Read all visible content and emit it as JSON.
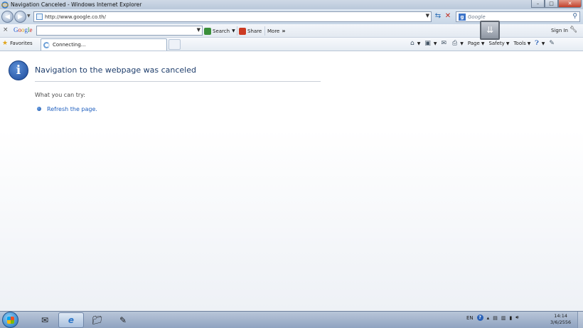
{
  "window": {
    "title": "Navigation Canceled - Windows Internet Explorer",
    "minimize": "–",
    "maximize": "□",
    "close": "✕"
  },
  "address_bar": {
    "url": "http://www.google.co.th/",
    "search_placeholder": "Google"
  },
  "google_toolbar": {
    "logo": [
      "G",
      "o",
      "o",
      "g",
      "l",
      "e"
    ],
    "search_label": "Search",
    "share_label": "Share",
    "more_label": "More",
    "more_glyph": "»",
    "sign_in_label": "Sign In"
  },
  "favorites_bar": {
    "favorites_label": "Favorites",
    "tab_label": "Connecting..."
  },
  "command_bar": {
    "page_label": "Page",
    "safety_label": "Safety",
    "tools_label": "Tools"
  },
  "content": {
    "heading": "Navigation to the webpage was canceled",
    "try_label": "What you can try:",
    "refresh_link": "Refresh the page."
  },
  "taskbar": {
    "language": "EN",
    "time": "14:14",
    "date": "3/6/2556"
  },
  "icons": [
    "ie-icon",
    "back-icon",
    "forward-icon",
    "refresh-icon",
    "stop-icon",
    "search-icon",
    "info-icon",
    "home-icon",
    "feeds-icon",
    "mail-icon",
    "print-icon",
    "help-icon",
    "favorites-star-icon",
    "windows-start-icon"
  ]
}
